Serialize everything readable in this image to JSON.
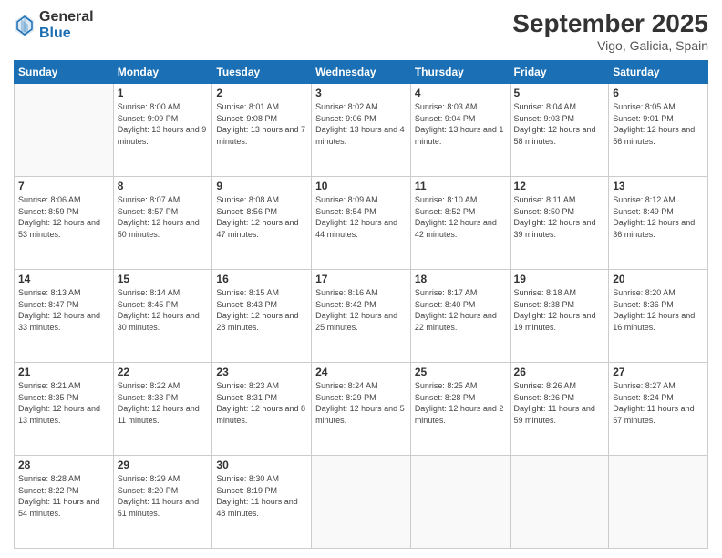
{
  "header": {
    "logo_general": "General",
    "logo_blue": "Blue",
    "month_title": "September 2025",
    "location": "Vigo, Galicia, Spain"
  },
  "weekdays": [
    "Sunday",
    "Monday",
    "Tuesday",
    "Wednesday",
    "Thursday",
    "Friday",
    "Saturday"
  ],
  "weeks": [
    [
      {
        "day": "",
        "sunrise": "",
        "sunset": "",
        "daylight": ""
      },
      {
        "day": "1",
        "sunrise": "Sunrise: 8:00 AM",
        "sunset": "Sunset: 9:09 PM",
        "daylight": "Daylight: 13 hours and 9 minutes."
      },
      {
        "day": "2",
        "sunrise": "Sunrise: 8:01 AM",
        "sunset": "Sunset: 9:08 PM",
        "daylight": "Daylight: 13 hours and 7 minutes."
      },
      {
        "day": "3",
        "sunrise": "Sunrise: 8:02 AM",
        "sunset": "Sunset: 9:06 PM",
        "daylight": "Daylight: 13 hours and 4 minutes."
      },
      {
        "day": "4",
        "sunrise": "Sunrise: 8:03 AM",
        "sunset": "Sunset: 9:04 PM",
        "daylight": "Daylight: 13 hours and 1 minute."
      },
      {
        "day": "5",
        "sunrise": "Sunrise: 8:04 AM",
        "sunset": "Sunset: 9:03 PM",
        "daylight": "Daylight: 12 hours and 58 minutes."
      },
      {
        "day": "6",
        "sunrise": "Sunrise: 8:05 AM",
        "sunset": "Sunset: 9:01 PM",
        "daylight": "Daylight: 12 hours and 56 minutes."
      }
    ],
    [
      {
        "day": "7",
        "sunrise": "Sunrise: 8:06 AM",
        "sunset": "Sunset: 8:59 PM",
        "daylight": "Daylight: 12 hours and 53 minutes."
      },
      {
        "day": "8",
        "sunrise": "Sunrise: 8:07 AM",
        "sunset": "Sunset: 8:57 PM",
        "daylight": "Daylight: 12 hours and 50 minutes."
      },
      {
        "day": "9",
        "sunrise": "Sunrise: 8:08 AM",
        "sunset": "Sunset: 8:56 PM",
        "daylight": "Daylight: 12 hours and 47 minutes."
      },
      {
        "day": "10",
        "sunrise": "Sunrise: 8:09 AM",
        "sunset": "Sunset: 8:54 PM",
        "daylight": "Daylight: 12 hours and 44 minutes."
      },
      {
        "day": "11",
        "sunrise": "Sunrise: 8:10 AM",
        "sunset": "Sunset: 8:52 PM",
        "daylight": "Daylight: 12 hours and 42 minutes."
      },
      {
        "day": "12",
        "sunrise": "Sunrise: 8:11 AM",
        "sunset": "Sunset: 8:50 PM",
        "daylight": "Daylight: 12 hours and 39 minutes."
      },
      {
        "day": "13",
        "sunrise": "Sunrise: 8:12 AM",
        "sunset": "Sunset: 8:49 PM",
        "daylight": "Daylight: 12 hours and 36 minutes."
      }
    ],
    [
      {
        "day": "14",
        "sunrise": "Sunrise: 8:13 AM",
        "sunset": "Sunset: 8:47 PM",
        "daylight": "Daylight: 12 hours and 33 minutes."
      },
      {
        "day": "15",
        "sunrise": "Sunrise: 8:14 AM",
        "sunset": "Sunset: 8:45 PM",
        "daylight": "Daylight: 12 hours and 30 minutes."
      },
      {
        "day": "16",
        "sunrise": "Sunrise: 8:15 AM",
        "sunset": "Sunset: 8:43 PM",
        "daylight": "Daylight: 12 hours and 28 minutes."
      },
      {
        "day": "17",
        "sunrise": "Sunrise: 8:16 AM",
        "sunset": "Sunset: 8:42 PM",
        "daylight": "Daylight: 12 hours and 25 minutes."
      },
      {
        "day": "18",
        "sunrise": "Sunrise: 8:17 AM",
        "sunset": "Sunset: 8:40 PM",
        "daylight": "Daylight: 12 hours and 22 minutes."
      },
      {
        "day": "19",
        "sunrise": "Sunrise: 8:18 AM",
        "sunset": "Sunset: 8:38 PM",
        "daylight": "Daylight: 12 hours and 19 minutes."
      },
      {
        "day": "20",
        "sunrise": "Sunrise: 8:20 AM",
        "sunset": "Sunset: 8:36 PM",
        "daylight": "Daylight: 12 hours and 16 minutes."
      }
    ],
    [
      {
        "day": "21",
        "sunrise": "Sunrise: 8:21 AM",
        "sunset": "Sunset: 8:35 PM",
        "daylight": "Daylight: 12 hours and 13 minutes."
      },
      {
        "day": "22",
        "sunrise": "Sunrise: 8:22 AM",
        "sunset": "Sunset: 8:33 PM",
        "daylight": "Daylight: 12 hours and 11 minutes."
      },
      {
        "day": "23",
        "sunrise": "Sunrise: 8:23 AM",
        "sunset": "Sunset: 8:31 PM",
        "daylight": "Daylight: 12 hours and 8 minutes."
      },
      {
        "day": "24",
        "sunrise": "Sunrise: 8:24 AM",
        "sunset": "Sunset: 8:29 PM",
        "daylight": "Daylight: 12 hours and 5 minutes."
      },
      {
        "day": "25",
        "sunrise": "Sunrise: 8:25 AM",
        "sunset": "Sunset: 8:28 PM",
        "daylight": "Daylight: 12 hours and 2 minutes."
      },
      {
        "day": "26",
        "sunrise": "Sunrise: 8:26 AM",
        "sunset": "Sunset: 8:26 PM",
        "daylight": "Daylight: 11 hours and 59 minutes."
      },
      {
        "day": "27",
        "sunrise": "Sunrise: 8:27 AM",
        "sunset": "Sunset: 8:24 PM",
        "daylight": "Daylight: 11 hours and 57 minutes."
      }
    ],
    [
      {
        "day": "28",
        "sunrise": "Sunrise: 8:28 AM",
        "sunset": "Sunset: 8:22 PM",
        "daylight": "Daylight: 11 hours and 54 minutes."
      },
      {
        "day": "29",
        "sunrise": "Sunrise: 8:29 AM",
        "sunset": "Sunset: 8:20 PM",
        "daylight": "Daylight: 11 hours and 51 minutes."
      },
      {
        "day": "30",
        "sunrise": "Sunrise: 8:30 AM",
        "sunset": "Sunset: 8:19 PM",
        "daylight": "Daylight: 11 hours and 48 minutes."
      },
      {
        "day": "",
        "sunrise": "",
        "sunset": "",
        "daylight": ""
      },
      {
        "day": "",
        "sunrise": "",
        "sunset": "",
        "daylight": ""
      },
      {
        "day": "",
        "sunrise": "",
        "sunset": "",
        "daylight": ""
      },
      {
        "day": "",
        "sunrise": "",
        "sunset": "",
        "daylight": ""
      }
    ]
  ]
}
